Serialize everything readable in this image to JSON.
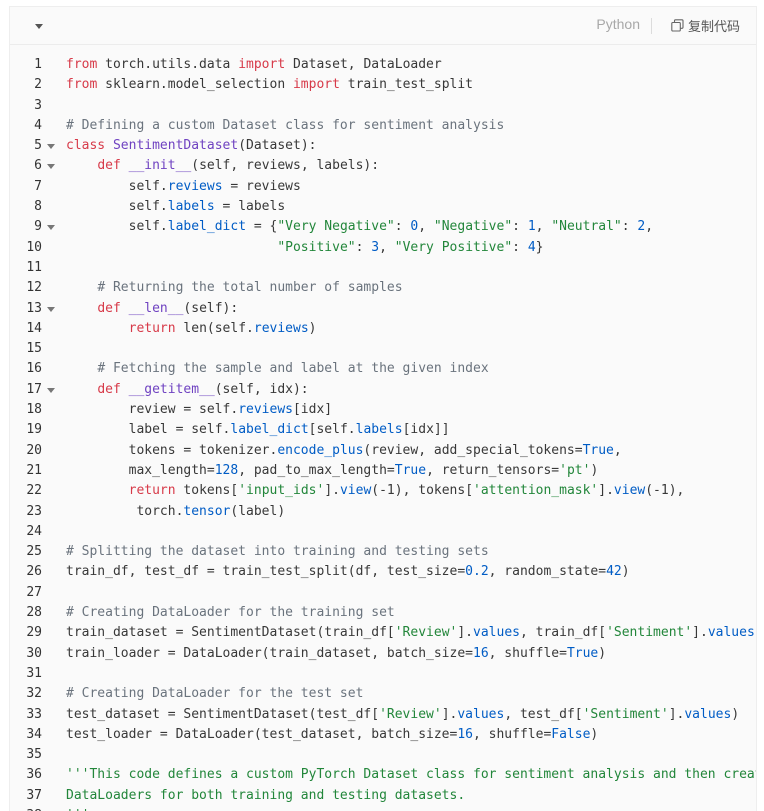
{
  "header": {
    "language": "Python",
    "copy_label": "复制代码"
  },
  "code": {
    "lines": [
      {
        "num": "1",
        "tokens": [
          {
            "t": "from",
            "c": "kw"
          },
          {
            "t": " torch.utils.data "
          },
          {
            "t": "import",
            "c": "kw"
          },
          {
            "t": " Dataset, DataLoader"
          }
        ]
      },
      {
        "num": "2",
        "tokens": [
          {
            "t": "from",
            "c": "kw"
          },
          {
            "t": " sklearn.model_selection "
          },
          {
            "t": "import",
            "c": "kw"
          },
          {
            "t": " train_test_split"
          }
        ]
      },
      {
        "num": "3",
        "tokens": []
      },
      {
        "num": "4",
        "tokens": [
          {
            "t": "# Defining a custom Dataset class for sentiment analysis",
            "c": "cm"
          }
        ]
      },
      {
        "num": "5",
        "fold": true,
        "tokens": [
          {
            "t": "class",
            "c": "kw"
          },
          {
            "t": " "
          },
          {
            "t": "SentimentDataset",
            "c": "fn"
          },
          {
            "t": "(Dataset):"
          }
        ]
      },
      {
        "num": "6",
        "fold": true,
        "tokens": [
          {
            "t": "    "
          },
          {
            "t": "def",
            "c": "kw"
          },
          {
            "t": " "
          },
          {
            "t": "__init__",
            "c": "fn"
          },
          {
            "t": "(self, reviews, labels):"
          }
        ]
      },
      {
        "num": "7",
        "tokens": [
          {
            "t": "        self."
          },
          {
            "t": "reviews",
            "c": "at"
          },
          {
            "t": " = reviews"
          }
        ]
      },
      {
        "num": "8",
        "tokens": [
          {
            "t": "        self."
          },
          {
            "t": "labels",
            "c": "at"
          },
          {
            "t": " = labels"
          }
        ]
      },
      {
        "num": "9",
        "fold": true,
        "tokens": [
          {
            "t": "        self."
          },
          {
            "t": "label_dict",
            "c": "at"
          },
          {
            "t": " = {"
          },
          {
            "t": "\"Very Negative\"",
            "c": "st"
          },
          {
            "t": ": "
          },
          {
            "t": "0",
            "c": "nm"
          },
          {
            "t": ", "
          },
          {
            "t": "\"Negative\"",
            "c": "st"
          },
          {
            "t": ": "
          },
          {
            "t": "1",
            "c": "nm"
          },
          {
            "t": ", "
          },
          {
            "t": "\"Neutral\"",
            "c": "st"
          },
          {
            "t": ": "
          },
          {
            "t": "2",
            "c": "nm"
          },
          {
            "t": ","
          }
        ]
      },
      {
        "num": "10",
        "tokens": [
          {
            "t": "                           "
          },
          {
            "t": "\"Positive\"",
            "c": "st"
          },
          {
            "t": ": "
          },
          {
            "t": "3",
            "c": "nm"
          },
          {
            "t": ", "
          },
          {
            "t": "\"Very Positive\"",
            "c": "st"
          },
          {
            "t": ": "
          },
          {
            "t": "4",
            "c": "nm"
          },
          {
            "t": "}"
          }
        ]
      },
      {
        "num": "11",
        "tokens": []
      },
      {
        "num": "12",
        "tokens": [
          {
            "t": "    "
          },
          {
            "t": "# Returning the total number of samples",
            "c": "cm"
          }
        ]
      },
      {
        "num": "13",
        "fold": true,
        "tokens": [
          {
            "t": "    "
          },
          {
            "t": "def",
            "c": "kw"
          },
          {
            "t": " "
          },
          {
            "t": "__len__",
            "c": "fn"
          },
          {
            "t": "(self):"
          }
        ]
      },
      {
        "num": "14",
        "tokens": [
          {
            "t": "        "
          },
          {
            "t": "return",
            "c": "kw"
          },
          {
            "t": " len(self."
          },
          {
            "t": "reviews",
            "c": "at"
          },
          {
            "t": ")"
          }
        ]
      },
      {
        "num": "15",
        "tokens": []
      },
      {
        "num": "16",
        "tokens": [
          {
            "t": "    "
          },
          {
            "t": "# Fetching the sample and label at the given index",
            "c": "cm"
          }
        ]
      },
      {
        "num": "17",
        "fold": true,
        "tokens": [
          {
            "t": "    "
          },
          {
            "t": "def",
            "c": "kw"
          },
          {
            "t": " "
          },
          {
            "t": "__getitem__",
            "c": "fn"
          },
          {
            "t": "(self, idx):"
          }
        ]
      },
      {
        "num": "18",
        "tokens": [
          {
            "t": "        review = self."
          },
          {
            "t": "reviews",
            "c": "at"
          },
          {
            "t": "[idx]"
          }
        ]
      },
      {
        "num": "19",
        "tokens": [
          {
            "t": "        label = self."
          },
          {
            "t": "label_dict",
            "c": "at"
          },
          {
            "t": "[self."
          },
          {
            "t": "labels",
            "c": "at"
          },
          {
            "t": "[idx]]"
          }
        ]
      },
      {
        "num": "20",
        "tokens": [
          {
            "t": "        tokens = tokenizer."
          },
          {
            "t": "encode_plus",
            "c": "at"
          },
          {
            "t": "(review, add_special_tokens="
          },
          {
            "t": "True",
            "c": "nm"
          },
          {
            "t": ","
          }
        ]
      },
      {
        "num": "21",
        "tokens": [
          {
            "t": "        max_length="
          },
          {
            "t": "128",
            "c": "nm"
          },
          {
            "t": ", pad_to_max_length="
          },
          {
            "t": "True",
            "c": "nm"
          },
          {
            "t": ", return_tensors="
          },
          {
            "t": "'pt'",
            "c": "st"
          },
          {
            "t": ")"
          }
        ]
      },
      {
        "num": "22",
        "tokens": [
          {
            "t": "        "
          },
          {
            "t": "return",
            "c": "kw"
          },
          {
            "t": " tokens["
          },
          {
            "t": "'input_ids'",
            "c": "st"
          },
          {
            "t": "]."
          },
          {
            "t": "view",
            "c": "at"
          },
          {
            "t": "(-1), tokens["
          },
          {
            "t": "'attention_mask'",
            "c": "st"
          },
          {
            "t": "]."
          },
          {
            "t": "view",
            "c": "at"
          },
          {
            "t": "(-1),"
          }
        ]
      },
      {
        "num": "23",
        "tokens": [
          {
            "t": "         torch."
          },
          {
            "t": "tensor",
            "c": "at"
          },
          {
            "t": "(label)"
          }
        ]
      },
      {
        "num": "24",
        "tokens": []
      },
      {
        "num": "25",
        "tokens": [
          {
            "t": "# Splitting the dataset into training and testing sets",
            "c": "cm"
          }
        ]
      },
      {
        "num": "26",
        "tokens": [
          {
            "t": "train_df, test_df = train_test_split(df, test_size="
          },
          {
            "t": "0.2",
            "c": "nm"
          },
          {
            "t": ", random_state="
          },
          {
            "t": "42",
            "c": "nm"
          },
          {
            "t": ")"
          }
        ]
      },
      {
        "num": "27",
        "tokens": []
      },
      {
        "num": "28",
        "tokens": [
          {
            "t": "# Creating DataLoader for the training set",
            "c": "cm"
          }
        ]
      },
      {
        "num": "29",
        "tokens": [
          {
            "t": "train_dataset = SentimentDataset(train_df["
          },
          {
            "t": "'Review'",
            "c": "st"
          },
          {
            "t": "]."
          },
          {
            "t": "values",
            "c": "at"
          },
          {
            "t": ", train_df["
          },
          {
            "t": "'Sentiment'",
            "c": "st"
          },
          {
            "t": "]."
          },
          {
            "t": "values",
            "c": "at"
          },
          {
            "t": ")"
          }
        ]
      },
      {
        "num": "30",
        "tokens": [
          {
            "t": "train_loader = DataLoader(train_dataset, batch_size="
          },
          {
            "t": "16",
            "c": "nm"
          },
          {
            "t": ", shuffle="
          },
          {
            "t": "True",
            "c": "nm"
          },
          {
            "t": ")"
          }
        ]
      },
      {
        "num": "31",
        "tokens": []
      },
      {
        "num": "32",
        "tokens": [
          {
            "t": "# Creating DataLoader for the test set",
            "c": "cm"
          }
        ]
      },
      {
        "num": "33",
        "tokens": [
          {
            "t": "test_dataset = SentimentDataset(test_df["
          },
          {
            "t": "'Review'",
            "c": "st"
          },
          {
            "t": "]."
          },
          {
            "t": "values",
            "c": "at"
          },
          {
            "t": ", test_df["
          },
          {
            "t": "'Sentiment'",
            "c": "st"
          },
          {
            "t": "]."
          },
          {
            "t": "values",
            "c": "at"
          },
          {
            "t": ")"
          }
        ]
      },
      {
        "num": "34",
        "tokens": [
          {
            "t": "test_loader = DataLoader(test_dataset, batch_size="
          },
          {
            "t": "16",
            "c": "nm"
          },
          {
            "t": ", shuffle="
          },
          {
            "t": "False",
            "c": "nm"
          },
          {
            "t": ")"
          }
        ]
      },
      {
        "num": "35",
        "tokens": []
      },
      {
        "num": "36",
        "tokens": [
          {
            "t": "'''This code defines a custom PyTorch Dataset class for sentiment analysis and then create",
            "c": "st"
          }
        ]
      },
      {
        "num": "37",
        "tokens": [
          {
            "t": "DataLoaders for both training and testing datasets.",
            "c": "st"
          }
        ]
      },
      {
        "num": "38",
        "tokens": [
          {
            "t": "'''",
            "c": "st"
          }
        ]
      }
    ]
  },
  "colors": {
    "keyword": "#d73a49",
    "function": "#6f42c1",
    "comment": "#6a737d",
    "string": "#22863a",
    "number": "#005cc5",
    "attribute": "#005cc5"
  },
  "icons": {
    "collapse": "caret-down-icon",
    "copy": "copy-icon",
    "fold": "fold-caret-icon"
  }
}
